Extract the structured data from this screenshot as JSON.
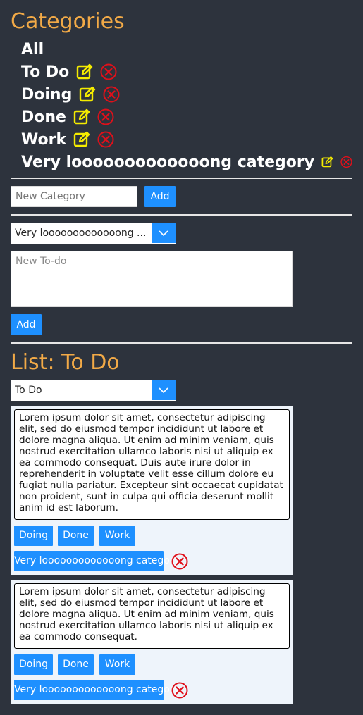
{
  "categories_heading": "Categories",
  "categories": [
    {
      "label": "All",
      "editable": false
    },
    {
      "label": "To Do",
      "editable": true
    },
    {
      "label": "Doing",
      "editable": true
    },
    {
      "label": "Done",
      "editable": true
    },
    {
      "label": "Work",
      "editable": true
    },
    {
      "label": "Very looooooooooooong category",
      "editable": true
    }
  ],
  "new_category": {
    "placeholder": "New Category",
    "value": "",
    "add_label": "Add"
  },
  "new_todo": {
    "category_select": "Very looooooooooooong ...",
    "placeholder": "New To-do",
    "value": "",
    "add_label": "Add"
  },
  "list": {
    "heading": "List: To Do",
    "selected_filter": "To Do",
    "items": [
      {
        "text": "Lorem ipsum dolor sit amet, consectetur adipiscing elit, sed do eiusmod tempor incididunt ut labore et dolore magna aliqua. Ut enim ad minim veniam, quis nostrud exercitation ullamco laboris nisi ut aliquip ex ea commodo consequat. Duis aute irure dolor in reprehenderit in voluptate velit esse cillum dolore eu fugiat nulla pariatur. Excepteur sint occaecat cupidatat non proident, sunt in culpa qui officia deserunt mollit anim id est laborum.",
        "move_buttons": [
          "Doing",
          "Done",
          "Work",
          "Very looooooooooooong category"
        ]
      },
      {
        "text": "Lorem ipsum dolor sit amet, consectetur adipiscing elit, sed do eiusmod tempor incididunt ut labore et dolore magna aliqua. Ut enim ad minim veniam, quis nostrud exercitation ullamco laboris nisi ut aliquip ex ea commodo consequat.",
        "move_buttons": [
          "Doing",
          "Done",
          "Work",
          "Very looooooooooooong category"
        ]
      }
    ]
  },
  "colors": {
    "background": "#2d333d",
    "heading": "#f2aa47",
    "accent": "#1e90ff",
    "edit_icon": "#f5ec00",
    "delete_icon": "#e0101a",
    "card": "#eef4fb"
  },
  "icons": {
    "edit": "edit-icon",
    "delete": "delete-icon",
    "chevron": "chevron-down-icon"
  }
}
